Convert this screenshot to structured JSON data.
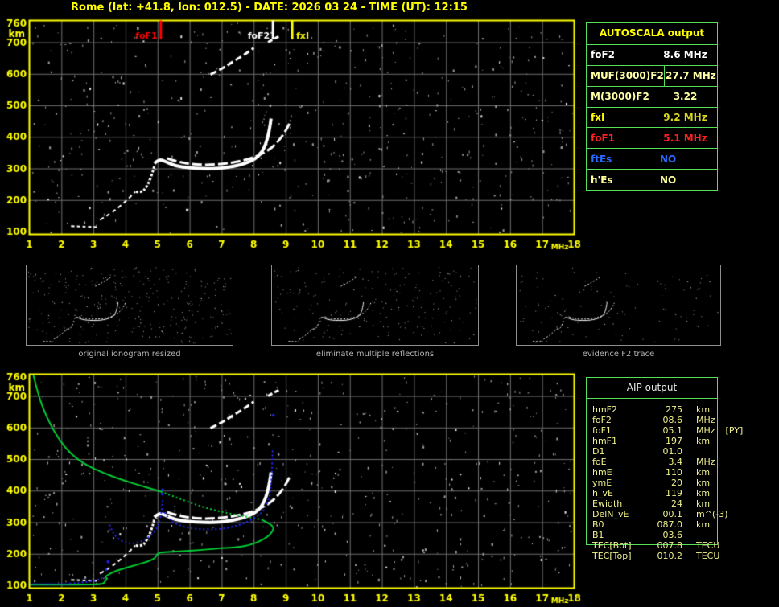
{
  "header": {
    "title": "Rome (lat: +41.8, lon: 012.5) - DATE: 2026 03 24 - TIME (UT): 12:15"
  },
  "autoscala": {
    "title": "AUTOSCALA output",
    "rows": [
      {
        "label": "foF2",
        "value": "8.6 MHz",
        "label_color": "#ffffff",
        "value_color": "#ffffff"
      },
      {
        "label": "MUF(3000)F2",
        "value": "27.7 MHz",
        "label_color": "#ffffa6",
        "value_color": "#ffffa6"
      },
      {
        "label": "M(3000)F2",
        "value": "3.22",
        "label_color": "#ffffa6",
        "value_color": "#ffffa6"
      },
      {
        "label": "fxI",
        "value": "9.2 MHz",
        "label_color": "#ffff00",
        "value_color": "#d8d81e"
      },
      {
        "label": "foF1",
        "value": "5.1 MHz",
        "label_color": "#ff2020",
        "value_color": "#ff2020"
      },
      {
        "label": "ftEs",
        "value": "NO",
        "label_color": "#2a6aff",
        "value_color": "#2a6aff"
      },
      {
        "label": "h'Es",
        "value": "NO",
        "label_color": "#ffff9a",
        "value_color": "#ffff9a"
      }
    ]
  },
  "aip": {
    "title": "AIP output",
    "rows": [
      {
        "label": "hmF2",
        "value": "275",
        "unit": "km",
        "extra": ""
      },
      {
        "label": "foF2",
        "value": "08.6",
        "unit": "MHz",
        "extra": ""
      },
      {
        "label": "foF1",
        "value": "05.1",
        "unit": "MHz",
        "extra": "[PY]"
      },
      {
        "label": "hmF1",
        "value": "197",
        "unit": "km",
        "extra": ""
      },
      {
        "label": "D1",
        "value": "01.0",
        "unit": "",
        "extra": ""
      },
      {
        "label": "foE",
        "value": "3.4",
        "unit": "MHz",
        "extra": ""
      },
      {
        "label": "hmE",
        "value": "110",
        "unit": "km",
        "extra": ""
      },
      {
        "label": "ymE",
        "value": "20",
        "unit": "km",
        "extra": ""
      },
      {
        "label": "h_vE",
        "value": "119",
        "unit": "km",
        "extra": ""
      },
      {
        "label": "Ewidth",
        "value": "24",
        "unit": "km",
        "extra": ""
      },
      {
        "label": "DelN_vE",
        "value": "00.1",
        "unit": "m^(-3)",
        "extra": ""
      },
      {
        "label": "B0",
        "value": "087.0",
        "unit": "km",
        "extra": ""
      },
      {
        "label": "B1",
        "value": "03.6",
        "unit": "",
        "extra": ""
      },
      {
        "label": "TEC[Bot]",
        "value": "007.8",
        "unit": "TECU",
        "extra": ""
      },
      {
        "label": "TEC[Top]",
        "value": "010.2",
        "unit": "TECU",
        "extra": ""
      }
    ]
  },
  "thumbnails": [
    {
      "caption": "original ionogram resized",
      "noise": 300,
      "seed": 21
    },
    {
      "caption": "eliminate multiple reflections",
      "noise": 200,
      "seed": 22
    },
    {
      "caption": "evidence F2 trace",
      "noise": 110,
      "seed": 23
    }
  ],
  "colors": {
    "frame": "#ffff00",
    "grid": "#6e6e6e",
    "axis_text": "#ffff00",
    "noise_dim": "#9c9c9c",
    "noise_bright": "#e0e0e0",
    "trace_white": "#ffffff",
    "profile_green": "#00cc33",
    "restored_blue": "#2424ff",
    "marker_foF1": "#ff0000",
    "marker_foF2": "#ffffff",
    "marker_fxI": "#ffff00"
  },
  "trace_library": {
    "E1": {
      "type": "line",
      "color": "#ffffff",
      "width": 2,
      "dash": [
        4,
        3
      ],
      "points": [
        [
          2.3,
          117
        ],
        [
          2.6,
          116
        ],
        [
          2.9,
          115
        ],
        [
          3.15,
          114
        ]
      ]
    },
    "F1a": {
      "type": "line",
      "color": "#ffffff",
      "width": 2,
      "dash": [
        5,
        4
      ],
      "points": [
        [
          3.2,
          137
        ],
        [
          3.55,
          158
        ],
        [
          3.85,
          182
        ],
        [
          4.1,
          205
        ],
        [
          4.3,
          226
        ]
      ]
    },
    "F1b": {
      "type": "line",
      "color": "#ffffff",
      "width": 3,
      "dash": [
        3,
        2
      ],
      "points": [
        [
          4.32,
          226
        ],
        [
          4.5,
          224
        ],
        [
          4.62,
          236
        ],
        [
          4.74,
          258
        ],
        [
          4.84,
          286
        ],
        [
          4.9,
          308
        ]
      ]
    },
    "F2o": {
      "type": "line",
      "color": "#ffffff",
      "width": 4,
      "dash": [],
      "points": [
        [
          4.9,
          316
        ],
        [
          5.05,
          330
        ],
        [
          5.25,
          322
        ],
        [
          5.55,
          308
        ],
        [
          5.95,
          302
        ],
        [
          6.45,
          299
        ],
        [
          6.95,
          300
        ],
        [
          7.35,
          306
        ],
        [
          7.75,
          316
        ],
        [
          8.05,
          330
        ],
        [
          8.25,
          350
        ],
        [
          8.38,
          378
        ],
        [
          8.47,
          412
        ],
        [
          8.52,
          442
        ],
        [
          8.54,
          458
        ]
      ]
    },
    "F2x": {
      "type": "line",
      "color": "#ffffff",
      "width": 3,
      "dash": [
        12,
        4
      ],
      "points": [
        [
          5.3,
          332
        ],
        [
          5.65,
          320
        ],
        [
          6.1,
          313
        ],
        [
          6.6,
          311
        ],
        [
          7.1,
          315
        ],
        [
          7.55,
          322
        ],
        [
          7.95,
          333
        ],
        [
          8.3,
          348
        ],
        [
          8.6,
          368
        ],
        [
          8.85,
          396
        ],
        [
          9.05,
          428
        ],
        [
          9.15,
          452
        ]
      ]
    },
    "hop2": {
      "type": "line",
      "color": "#ffffff",
      "width": 3,
      "dash": [
        8,
        4
      ],
      "points": [
        [
          6.65,
          598
        ],
        [
          7.0,
          616
        ],
        [
          7.35,
          638
        ],
        [
          7.7,
          660
        ],
        [
          8.0,
          682
        ]
      ]
    },
    "hop2b": {
      "type": "line",
      "color": "#ffffff",
      "width": 3,
      "dash": [
        6,
        3
      ],
      "points": [
        [
          8.45,
          700
        ],
        [
          8.6,
          710
        ],
        [
          8.78,
          718
        ]
      ]
    },
    "P1": {
      "type": "line",
      "color": "#00cc33",
      "width": 2,
      "dash": [],
      "points": [
        [
          1.12,
          768
        ],
        [
          1.25,
          715
        ],
        [
          1.42,
          662
        ],
        [
          1.65,
          610
        ],
        [
          1.95,
          558
        ],
        [
          2.3,
          515
        ],
        [
          2.75,
          482
        ],
        [
          3.3,
          456
        ],
        [
          3.95,
          432
        ],
        [
          4.6,
          412
        ],
        [
          5.1,
          397
        ]
      ]
    },
    "P2": {
      "type": "line",
      "color": "#00cc33",
      "width": 2,
      "dash": [
        2,
        3
      ],
      "points": [
        [
          5.1,
          397
        ],
        [
          5.7,
          374
        ],
        [
          6.4,
          348
        ],
        [
          7.1,
          330
        ],
        [
          7.8,
          317
        ],
        [
          8.25,
          308
        ]
      ]
    },
    "P3": {
      "type": "line",
      "color": "#00cc33",
      "width": 2,
      "dash": [],
      "points": [
        [
          8.25,
          308
        ],
        [
          8.5,
          295
        ],
        [
          8.62,
          285
        ],
        [
          8.6,
          272
        ],
        [
          8.45,
          255
        ],
        [
          8.2,
          240
        ],
        [
          7.9,
          228
        ],
        [
          7.5,
          220
        ],
        [
          7.0,
          218
        ],
        [
          6.4,
          212
        ],
        [
          5.8,
          208
        ],
        [
          5.3,
          206
        ],
        [
          5.0,
          203
        ],
        [
          4.95,
          188
        ],
        [
          4.75,
          177
        ],
        [
          4.35,
          165
        ],
        [
          3.9,
          152
        ],
        [
          3.6,
          142
        ],
        [
          3.45,
          133
        ],
        [
          3.36,
          127
        ],
        [
          3.44,
          121
        ],
        [
          3.36,
          113
        ],
        [
          3.3,
          103
        ],
        [
          2.6,
          102
        ],
        [
          1.0,
          102
        ]
      ]
    },
    "B1": {
      "type": "line",
      "color": "#2424ff",
      "width": 2,
      "dash": [
        2,
        2
      ],
      "points": [
        [
          1.0,
          104
        ],
        [
          2.25,
          104
        ]
      ]
    },
    "B2": {
      "type": "line",
      "color": "#2424ff",
      "width": 2,
      "dash": [
        2,
        3
      ],
      "points": [
        [
          2.25,
          105
        ],
        [
          2.6,
          108
        ],
        [
          2.95,
          113
        ],
        [
          3.2,
          119
        ],
        [
          3.33,
          126
        ]
      ]
    },
    "B4": {
      "type": "line",
      "color": "#2424ff",
      "width": 2,
      "dash": [
        2,
        3
      ],
      "points": [
        [
          3.5,
          292
        ],
        [
          3.58,
          272
        ],
        [
          3.7,
          254
        ],
        [
          3.88,
          240
        ],
        [
          4.1,
          232
        ],
        [
          4.35,
          234
        ],
        [
          4.6,
          244
        ],
        [
          4.8,
          258
        ],
        [
          4.95,
          276
        ],
        [
          5.05,
          298
        ],
        [
          5.12,
          330
        ],
        [
          5.15,
          355
        ],
        [
          5.16,
          372
        ]
      ]
    },
    "B6": {
      "type": "line",
      "color": "#2424ff",
      "width": 2,
      "dash": [
        2,
        3
      ],
      "points": [
        [
          5.22,
          332
        ],
        [
          5.35,
          310
        ],
        [
          5.55,
          296
        ],
        [
          5.8,
          286
        ],
        [
          6.1,
          280
        ],
        [
          6.45,
          277
        ],
        [
          6.8,
          277
        ],
        [
          7.15,
          281
        ],
        [
          7.5,
          290
        ],
        [
          7.8,
          301
        ],
        [
          8.05,
          315
        ],
        [
          8.25,
          330
        ],
        [
          8.38,
          348
        ],
        [
          8.47,
          372
        ],
        [
          8.52,
          400
        ],
        [
          8.55,
          432
        ],
        [
          8.57,
          465
        ],
        [
          8.58,
          500
        ],
        [
          8.59,
          528
        ]
      ]
    },
    "Bdots": {
      "type": "points",
      "color": "#2424ff",
      "size": 3,
      "points": [
        [
          5.14,
          390
        ],
        [
          5.15,
          404
        ],
        [
          8.6,
          640
        ],
        [
          3.38,
          152
        ],
        [
          3.44,
          176
        ]
      ]
    }
  },
  "chart_data": [
    {
      "id": "ionogram-top",
      "type": "scatter",
      "title": "",
      "xlabel": "MHz",
      "ylabel": "km",
      "xlim": [
        1,
        18
      ],
      "ylim": [
        100,
        760
      ],
      "grid": true,
      "x_ticks": [
        1,
        2,
        3,
        4,
        5,
        6,
        7,
        8,
        9,
        10,
        11,
        12,
        13,
        14,
        15,
        16,
        17,
        18
      ],
      "y_ticks": [
        760,
        700,
        600,
        500,
        400,
        300,
        200,
        100
      ],
      "markers": [
        {
          "name": "foF1",
          "mhz": 5.1,
          "color": "#ff0000",
          "side": "left"
        },
        {
          "name": "foF2",
          "mhz": 8.6,
          "color": "#ffffff",
          "side": "left"
        },
        {
          "name": "fxI",
          "mhz": 9.2,
          "color": "#ffff00",
          "side": "right"
        }
      ],
      "traces": [
        "E1",
        "F1a",
        "F1b",
        "F2o",
        "F2x",
        "hop2",
        "hop2b"
      ],
      "noise": {
        "count": 600,
        "seed": 7
      }
    },
    {
      "id": "ionogram-bottom-with-profile",
      "type": "scatter",
      "title": "",
      "xlabel": "MHz",
      "ylabel": "km",
      "xlim": [
        1,
        18
      ],
      "ylim": [
        100,
        760
      ],
      "grid": true,
      "x_ticks": [
        1,
        2,
        3,
        4,
        5,
        6,
        7,
        8,
        9,
        10,
        11,
        12,
        13,
        14,
        15,
        16,
        17,
        18
      ],
      "y_ticks": [
        760,
        700,
        600,
        500,
        400,
        300,
        200,
        100
      ],
      "markers": [],
      "traces": [
        "E1",
        "F1a",
        "F1b",
        "F2o",
        "F2x",
        "hop2",
        "hop2b",
        "P1",
        "P2",
        "P3",
        "B1",
        "B2",
        "B4",
        "B6",
        "Bdots"
      ],
      "noise": {
        "count": 600,
        "seed": 13
      }
    }
  ]
}
